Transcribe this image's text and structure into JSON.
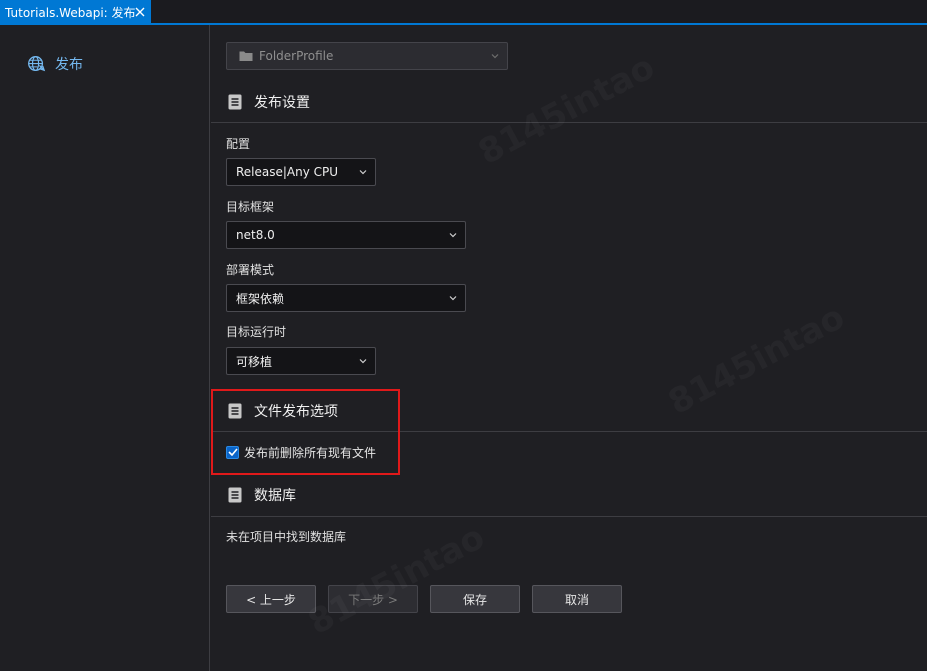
{
  "tab": {
    "title": "Tutorials.Webapi: 发布"
  },
  "sidebar": {
    "items": [
      {
        "label": "发布"
      }
    ]
  },
  "profile": {
    "value": "FolderProfile"
  },
  "sections": {
    "publish_settings": "发布设置",
    "file_publish_options": "文件发布选项",
    "database": "数据库"
  },
  "fields": {
    "configuration": {
      "label": "配置",
      "value": "Release|Any CPU"
    },
    "target_framework": {
      "label": "目标框架",
      "value": "net8.0"
    },
    "deployment_mode": {
      "label": "部署模式",
      "value": "框架依赖"
    },
    "target_runtime": {
      "label": "目标运行时",
      "value": "可移植"
    }
  },
  "options": {
    "delete_existing": {
      "label": "发布前删除所有现有文件",
      "checked": true
    }
  },
  "database": {
    "empty_text": "未在项目中找到数据库"
  },
  "buttons": {
    "prev": "< 上一步",
    "next": "下一步 >",
    "save": "保存",
    "cancel": "取消"
  },
  "watermark": "8145intao",
  "colors": {
    "accent": "#0078d4",
    "highlight": "#e0191a",
    "link": "#74b8ef"
  }
}
